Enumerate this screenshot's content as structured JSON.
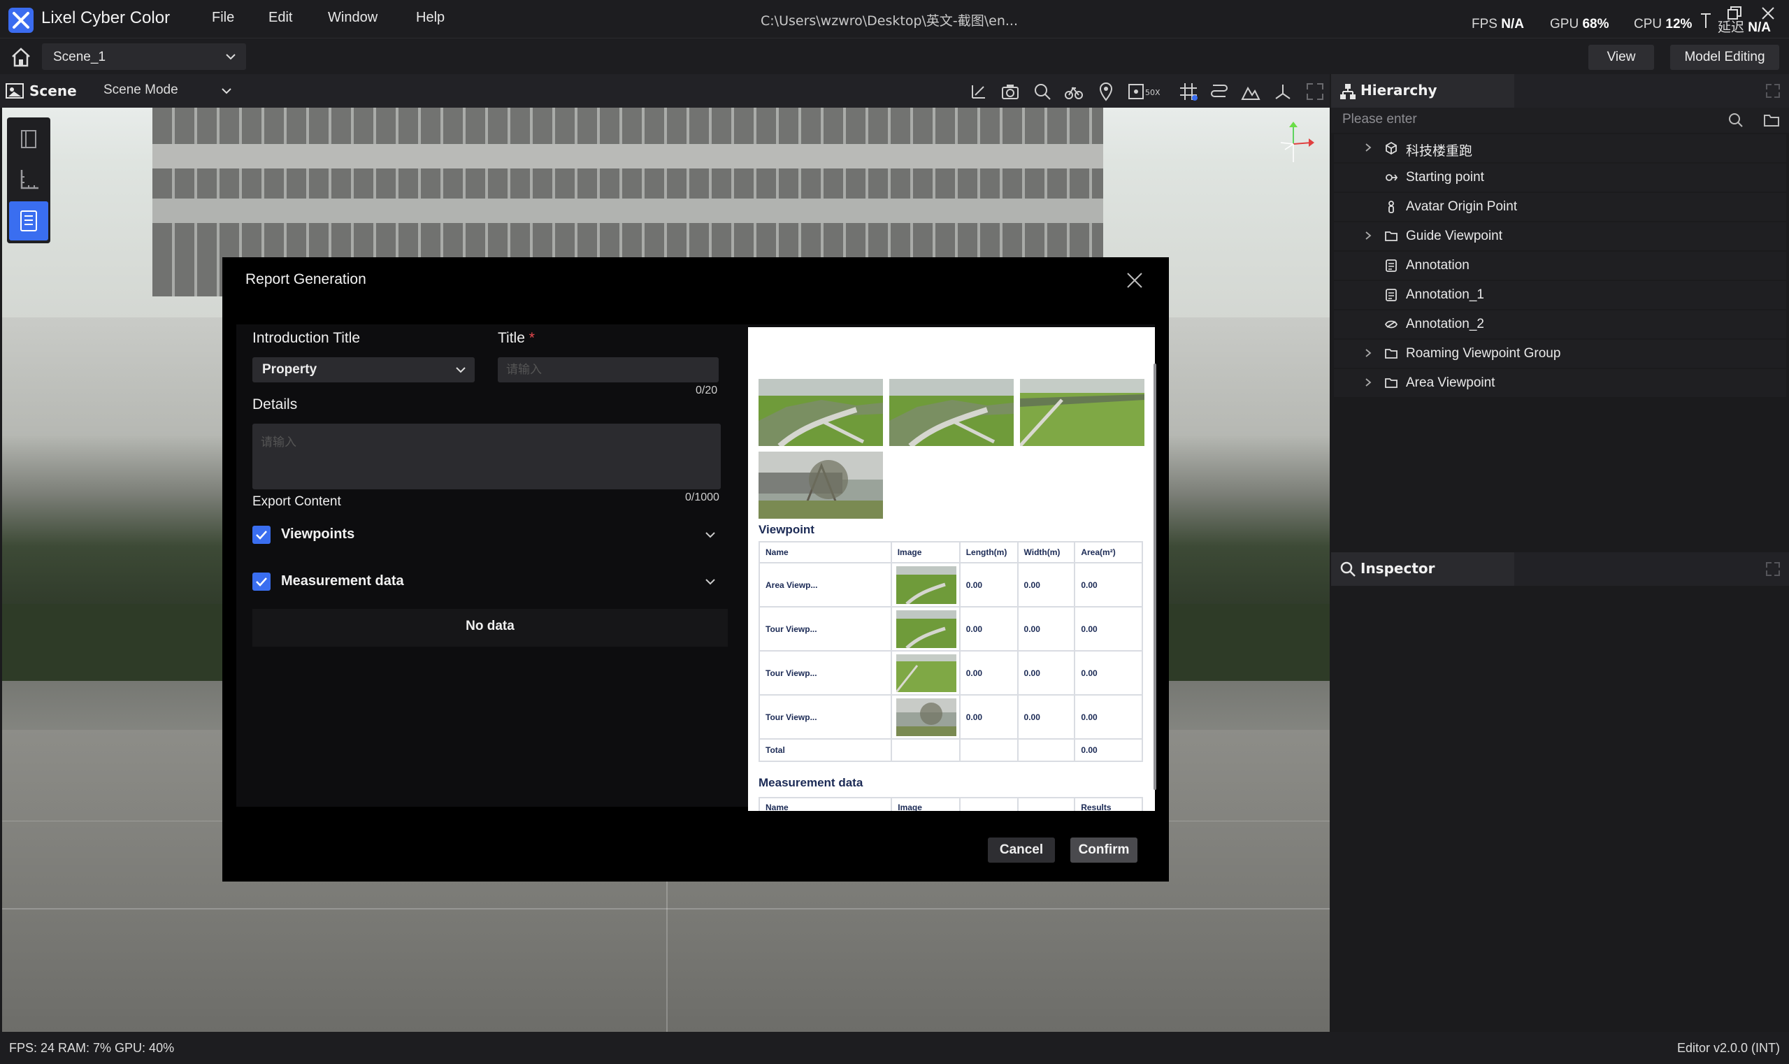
{
  "app": {
    "title": "Lixel Cyber Color",
    "menu": [
      "File",
      "Edit",
      "Window",
      "Help"
    ],
    "path": "C:\\Users\\wzwro\\Desktop\\英文-截图\\en...",
    "fps_label": "FPS",
    "fps_value": "N/A",
    "gpu_label": "GPU",
    "gpu_value": "68%",
    "cpu_label": "CPU",
    "cpu_value": "12%",
    "latency_label": "延迟",
    "latency_value": "N/A"
  },
  "scenebar": {
    "scene": "Scene_1",
    "view_btn": "View",
    "model_btn": "Model Editing"
  },
  "viewport": {
    "tab": "Scene",
    "mode": "Scene Mode"
  },
  "hierarchy": {
    "title": "Hierarchy",
    "search_placeholder": "Please enter",
    "items": [
      {
        "label": "科技楼重跑",
        "icon": "cube-icon",
        "expandable": true
      },
      {
        "label": "Starting point",
        "icon": "pin-icon",
        "expandable": false
      },
      {
        "label": "Avatar Origin Point",
        "icon": "person-icon",
        "expandable": false
      },
      {
        "label": "Guide Viewpoint",
        "icon": "folder-icon",
        "expandable": true
      },
      {
        "label": "Annotation",
        "icon": "note-icon",
        "expandable": false
      },
      {
        "label": "Annotation_1",
        "icon": "note-icon",
        "expandable": false
      },
      {
        "label": "Annotation_2",
        "icon": "eye-icon",
        "expandable": false
      },
      {
        "label": "Roaming Viewpoint Group",
        "icon": "folder-icon",
        "expandable": true
      },
      {
        "label": "Area Viewpoint",
        "icon": "folder-icon",
        "expandable": true
      }
    ]
  },
  "inspector": {
    "title": "Inspector"
  },
  "status": {
    "left": "FPS: 24  RAM: 7%  GPU: 40%",
    "right": "Editor v2.0.0 (INT)"
  },
  "modal": {
    "title": "Report Generation",
    "intro_title_label": "Introduction Title",
    "intro_title_value": "Property",
    "title_label": "Title",
    "title_required": "*",
    "title_placeholder": "请输入",
    "title_counter": "0/20",
    "details_label": "Details",
    "details_placeholder": "请输入",
    "details_counter": "0/1000",
    "export_label": "Export Content",
    "export_viewpoints": "Viewpoints",
    "export_measurement": "Measurement data",
    "no_data": "No data",
    "cancel": "Cancel",
    "confirm": "Confirm"
  },
  "preview": {
    "viewpoint_heading": "Viewpoint",
    "columns": [
      "Name",
      "Image",
      "Length(m)",
      "Width(m)",
      "Area(m²)"
    ],
    "rows": [
      {
        "name": "Area Viewp...",
        "length": "0.00",
        "width": "0.00",
        "area": "0.00"
      },
      {
        "name": "Tour Viewp...",
        "length": "0.00",
        "width": "0.00",
        "area": "0.00"
      },
      {
        "name": "Tour Viewp...",
        "length": "0.00",
        "width": "0.00",
        "area": "0.00"
      },
      {
        "name": "Tour Viewp...",
        "length": "0.00",
        "width": "0.00",
        "area": "0.00"
      }
    ],
    "total_label": "Total",
    "total_area": "0.00",
    "measurement_heading": "Measurement data",
    "m_columns": [
      "Name",
      "Image",
      "",
      "",
      "Results"
    ]
  }
}
